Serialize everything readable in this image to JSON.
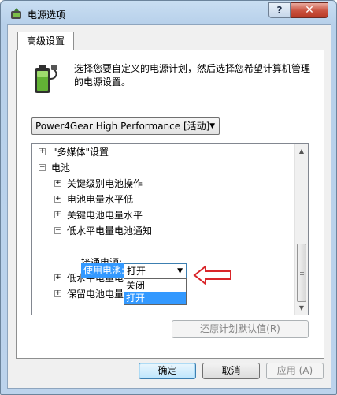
{
  "window": {
    "title": "电源选项",
    "help_label": "?",
    "close_label": "✕"
  },
  "tab": {
    "label": "高级设置"
  },
  "intro": {
    "text": "选择您要自定义的电源计划，然后选择您希望计算机管理的电源设置。"
  },
  "plan_select": {
    "value": "Power4Gear High Performance [活动]"
  },
  "tree": {
    "items": [
      {
        "label": "\"多媒体\"设置",
        "expander": "+"
      },
      {
        "label": "电池",
        "expander": "−"
      },
      {
        "label": "关键级别电池操作",
        "expander": "+"
      },
      {
        "label": "电池电量水平低",
        "expander": "+"
      },
      {
        "label": "关键电池电量水平",
        "expander": "+"
      },
      {
        "label": "低水平电量电池通知",
        "expander": "−"
      },
      {
        "label": "接通电源:",
        "expander": ""
      },
      {
        "label": "低水平电量电",
        "expander": "+"
      },
      {
        "label": "保留电池电量",
        "expander": "+"
      }
    ],
    "setting_label": "使用电池:",
    "setting_value": "打开",
    "options": [
      "关闭",
      "打开"
    ]
  },
  "buttons": {
    "restore": "还原计划默认值(R)",
    "ok": "确定",
    "cancel": "取消",
    "apply": "应用 (A)"
  },
  "colors": {
    "selection": "#3399ff",
    "callout_arrow": "#d9262a"
  }
}
